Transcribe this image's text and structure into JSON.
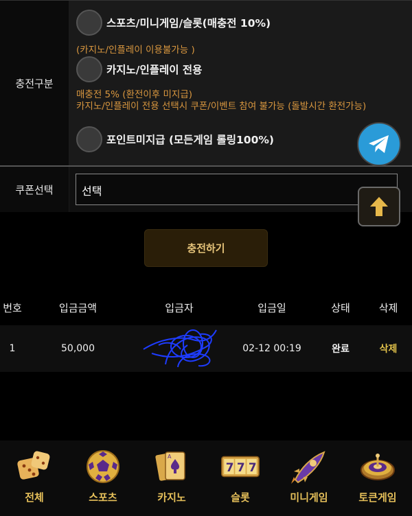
{
  "charge_section": {
    "label": "충전구분",
    "options": [
      {
        "label": "스포츠/미니게임/슬롯(매충전 10%)"
      },
      {
        "label": "카지노/인플레이 전용"
      },
      {
        "label": "포인트미지급 (모든게임 롤링100%)"
      }
    ],
    "notes": [
      "(카지노/인플레이 이용불가능 )",
      "매충전 5% (환전이후 미지급)",
      "카지노/인플레이 전용 선택시 쿠폰/이벤트 참여 불가능 (돌발시간 환전가능)"
    ]
  },
  "coupon": {
    "label": "쿠폰선택",
    "value": "선택"
  },
  "charge_button": "충전하기",
  "table": {
    "headers": [
      "번호",
      "입금금액",
      "입금자",
      "입금일",
      "상태",
      "삭제"
    ],
    "rows": [
      {
        "no": "1",
        "amount": "50,000",
        "date": "02-12 00:19",
        "status": "완료",
        "delete": "삭제"
      }
    ]
  },
  "bottom_nav": [
    {
      "label": "전체",
      "icon": "dice-icon"
    },
    {
      "label": "스포츠",
      "icon": "soccer-ball-icon"
    },
    {
      "label": "카지노",
      "icon": "playing-cards-icon"
    },
    {
      "label": "슬롯",
      "icon": "slot-777-icon"
    },
    {
      "label": "미니게임",
      "icon": "rocket-icon"
    },
    {
      "label": "토큰게임",
      "icon": "roulette-icon"
    }
  ],
  "colors": {
    "accent_gold": "#e6c05a",
    "note_orange": "#d9973f",
    "telegram_blue": "#2a9bd8"
  }
}
